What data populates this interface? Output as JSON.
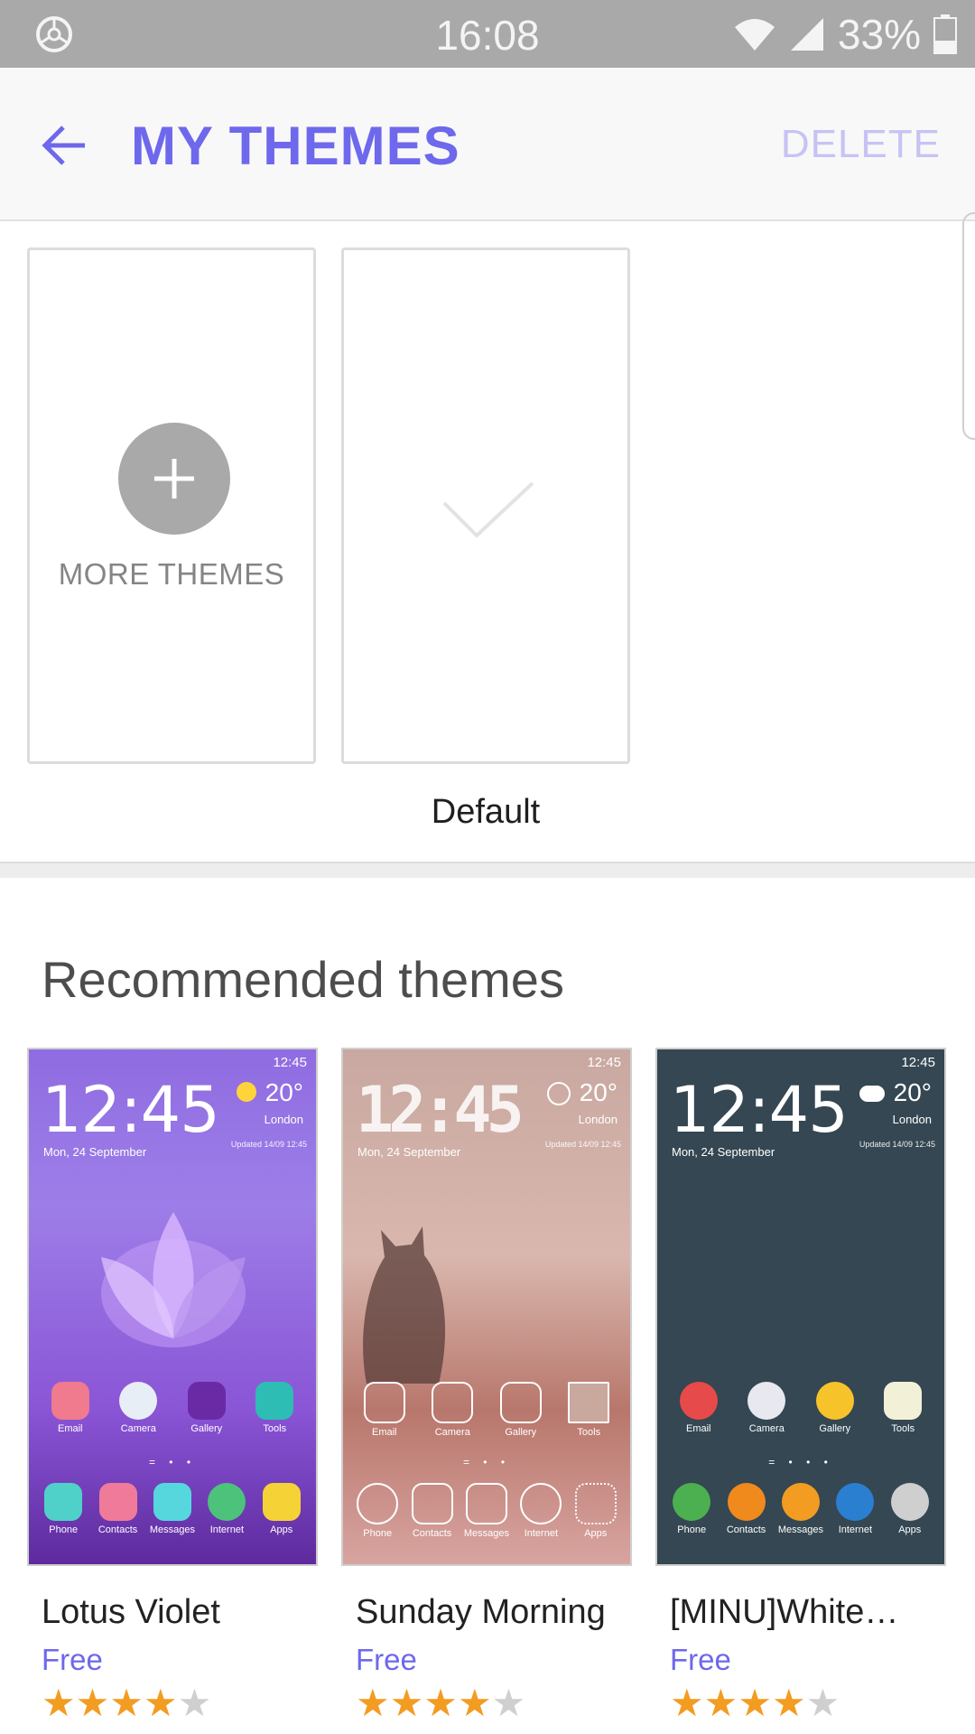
{
  "status_bar": {
    "time": "16:08",
    "battery": "33%",
    "icons": [
      "steering-wheel-icon",
      "wifi-icon",
      "signal-icon",
      "battery-icon"
    ]
  },
  "app_bar": {
    "title": "MY THEMES",
    "delete_label": "DELETE",
    "back_icon": "back-arrow-icon"
  },
  "my_themes": {
    "more_label": "MORE THEMES",
    "default_label": "Default"
  },
  "recommended": {
    "title": "Recommended themes",
    "themes": [
      {
        "name": "Lotus Violet",
        "price": "Free",
        "rating": 4.5,
        "preview": {
          "status": "12:45",
          "clock": "12:45",
          "date": "Mon, 24 September",
          "temp": "20°",
          "city": "London",
          "updated": "Updated 14/09 12:45",
          "apps_top": [
            "Email",
            "Camera",
            "Gallery",
            "Tools"
          ],
          "apps_bottom": [
            "Phone",
            "Contacts",
            "Messages",
            "Internet",
            "Apps"
          ]
        }
      },
      {
        "name": "Sunday Morning",
        "price": "Free",
        "rating": 4.5,
        "preview": {
          "status": "12:45",
          "clock": "12:45",
          "date": "Mon, 24 September",
          "temp": "20°",
          "city": "London",
          "updated": "Updated 14/09 12:45",
          "apps_top": [
            "Email",
            "Camera",
            "Gallery",
            "Tools"
          ],
          "apps_bottom": [
            "Phone",
            "Contacts",
            "Messages",
            "Internet",
            "Apps"
          ]
        }
      },
      {
        "name": "[MINU]White…",
        "price": "Free",
        "rating": 4.5,
        "preview": {
          "status": "12:45",
          "clock": "12:45",
          "date": "Mon, 24 September",
          "temp": "20°",
          "city": "London",
          "updated": "Updated 14/09 12:45",
          "apps_top": [
            "Email",
            "Camera",
            "Gallery",
            "Tools"
          ],
          "apps_bottom": [
            "Phone",
            "Contacts",
            "Messages",
            "Internet",
            "Apps"
          ]
        }
      }
    ]
  },
  "colors": {
    "accent": "#6e68ec",
    "accent_disabled": "#c6c3f4",
    "star": "#f39c22",
    "status_bar": "#a9a9a9"
  }
}
